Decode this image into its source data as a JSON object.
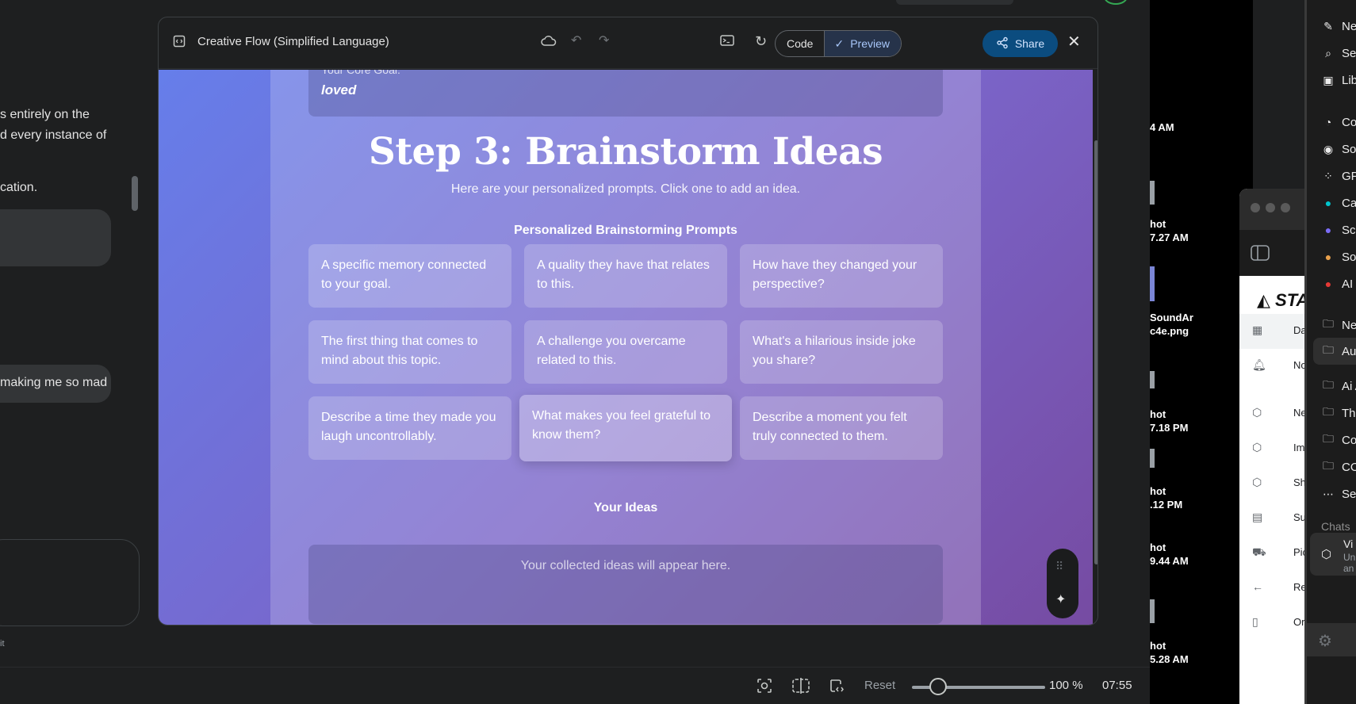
{
  "chat": {
    "lines": [
      "s entirely on the",
      "d every instance of",
      "cation.",
      "making me so mad"
    ],
    "footer": "it"
  },
  "canvas": {
    "title": "Creative Flow (Simplified Language)",
    "code_label": "Code",
    "preview_label": "Preview",
    "share_label": "Share"
  },
  "preview": {
    "goal_label": "Your Core Goal:",
    "goal_value": "loved",
    "step_title": "Step 3: Brainstorm Ideas",
    "step_subtitle": "Here are your personalized prompts. Click one to add an idea.",
    "prompts_heading": "Personalized Brainstorming Prompts",
    "prompts": [
      "A specific memory connected to your goal.",
      "A quality they have that relates to this.",
      "How have they changed your perspective?",
      "The first thing that comes to mind about this topic.",
      "A challenge you overcame related to this.",
      "What's a hilarious inside joke you share?",
      "Describe a time they made you laugh uncontrollably.",
      "What makes you feel grateful to know them?",
      "Describe a moment you felt truly connected to them."
    ],
    "ideas_heading": "Your Ideas",
    "ideas_placeholder": "Your collected ideas will appear here."
  },
  "bottom_bar": {
    "reset_label": "Reset",
    "zoom_value": "100 %",
    "clock": "07:55"
  },
  "desktop": {
    "labels": [
      "4 AM",
      "hot",
      "7.27 AM",
      "SoundAr",
      "c4e.png",
      "hot",
      "7.18 PM",
      "hot",
      ".12 PM",
      "hot",
      "9.44 AM",
      "hot",
      "5.28 AM"
    ]
  },
  "app_window": {
    "logo_text": "STA",
    "rows": [
      {
        "icon": "dashboard-icon",
        "label": "Da"
      },
      {
        "icon": "bell-icon",
        "label": "No"
      },
      {
        "icon": "box-icon",
        "label": "Ne"
      },
      {
        "icon": "box-icon",
        "label": "Imp"
      },
      {
        "icon": "box-icon",
        "label": "Shi"
      },
      {
        "icon": "store-icon",
        "label": "Su"
      },
      {
        "icon": "truck-icon",
        "label": "Pic"
      },
      {
        "icon": "arrow-left-icon",
        "label": "Re"
      },
      {
        "icon": "clipboard-icon",
        "label": "Orders"
      }
    ]
  },
  "right_menu": {
    "items": [
      {
        "icon": "edit-icon",
        "label": "New"
      },
      {
        "icon": "search-icon",
        "label": "Sea"
      },
      {
        "icon": "library-icon",
        "label": "Lib"
      },
      {
        "icon": "codex-icon",
        "label": "Cod"
      },
      {
        "icon": "sora-icon",
        "label": "Sor"
      },
      {
        "icon": "gpts-icon",
        "label": "GPT"
      },
      {
        "icon": "canva-icon",
        "label": "Can"
      },
      {
        "icon": "app-icon",
        "label": "Scri"
      },
      {
        "icon": "app-icon",
        "label": "Son"
      },
      {
        "icon": "app-icon",
        "label": "AI H"
      },
      {
        "icon": "new-folder-icon",
        "label": "New"
      },
      {
        "icon": "folder-icon",
        "label": "Aud"
      },
      {
        "icon": "folder-icon",
        "label": "Ai A"
      },
      {
        "icon": "folder-icon",
        "label": "The"
      },
      {
        "icon": "folder-icon",
        "label": "Coo"
      },
      {
        "icon": "folder-icon",
        "label": "CO"
      },
      {
        "icon": "more-icon",
        "label": "See"
      }
    ],
    "chats_label": "Chats",
    "chat_item": {
      "title": "Vi",
      "line1": "Un",
      "line2": "an"
    }
  },
  "colors": {
    "gradient_start": "#667eea",
    "gradient_end": "#764ba2",
    "share_button": "#0b4c7f",
    "preview_active": "#a8c7fa"
  }
}
